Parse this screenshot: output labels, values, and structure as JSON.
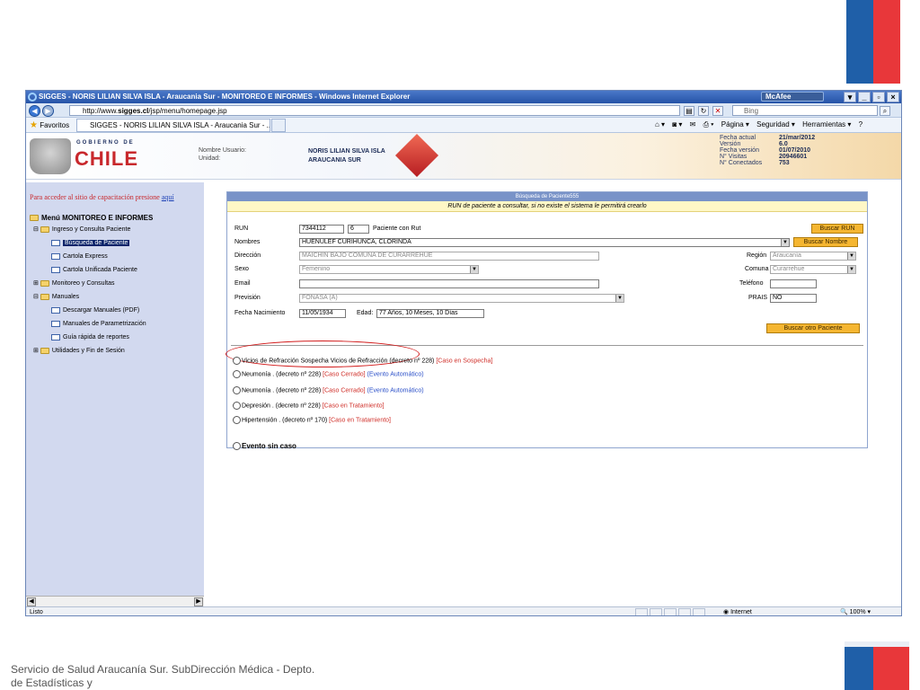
{
  "slide": {
    "footer": "Servicio de Salud Araucanía Sur. SubDirección Médica - Depto. de Estadísticas y"
  },
  "browser": {
    "title": "SIGGES - NORIS LILIAN SILVA ISLA - Araucania Sur - MONITOREO E INFORMES - Windows Internet Explorer",
    "mcafee": "McAfee",
    "url_prefix": "http://www.",
    "url_host": "sigges.cl",
    "url_path": "/jsp/menu/homepage.jsp",
    "search_placeholder": "Bing",
    "favorites_label": "Favoritos",
    "tab_label": "SIGGES - NORIS LILIAN SILVA ISLA - Araucania Sur - ...",
    "commands": [
      "Página ▾",
      "Seguridad ▾",
      "Herramientas ▾"
    ],
    "status_left": "Listo",
    "status_zone": "Internet",
    "zoom": "100%"
  },
  "header": {
    "gobierno": "GOBIERNO DE",
    "chile": "CHILE",
    "user_label": "Nombre Usuario:",
    "unit_label": "Unidad:",
    "user_name": "NORIS LILIAN SILVA ISLA",
    "unit_name": "ARAUCANIA SUR",
    "stats_labels": [
      "Fecha actual",
      "Versión",
      "Fecha versión",
      "N° Visitas",
      "N° Conectados"
    ],
    "stats_values": [
      "21/mar/2012",
      "6.0",
      "01/07/2010",
      "20946601",
      "753"
    ]
  },
  "sidebar": {
    "training_text": "Para acceder al sitio de capacitación presione ",
    "training_link": "aquí",
    "menu_root": "Menú MONITOREO E INFORMES",
    "items": [
      "Ingreso y Consulta Paciente",
      "Búsqueda de Paciente",
      "Cartola Express",
      "Cartola Unificada Paciente",
      "Monitoreo y Consultas",
      "Manuales",
      "Descargar Manuales (PDF)",
      "Manuales de Parametrización",
      "Guía rápida de reportes",
      "Utilidades y Fin de Sesión"
    ]
  },
  "form": {
    "title": "Búsqueda de Paciente555",
    "subtitle": "RUN de paciente a consultar, si no existe el sistema le permitirá crearlo",
    "run_label": "RUN",
    "run_value": "7344112",
    "dv_value": "6",
    "run_note": "Paciente con Rut",
    "nombres_label": "Nombres",
    "nombres_value": "HUENULEF CURIHUNCA, CLORINDA",
    "direccion_label": "Dirección",
    "direccion_value": "MAICHIN BAJO COMUNA DE CURARREHUE",
    "sexo_label": "Sexo",
    "sexo_value": "Femenino",
    "email_label": "Email",
    "email_value": "",
    "prevision_label": "Previsión",
    "prevision_value": "FONASA (A)",
    "nacimiento_label": "Fecha Nacimiento",
    "nacimiento_value": "11/05/1934",
    "edad_label": "Edad",
    "edad_value": "77 Años, 10 Meses, 10 Días",
    "region_label": "Región",
    "region_value": "Araucanía",
    "comuna_label": "Comuna",
    "comuna_value": "Curarrehue",
    "telefono_label": "Teléfono",
    "telefono_value": "",
    "prais_label": "PRAIS",
    "prais_value": "NO",
    "btn_run": "Buscar RUN",
    "btn_nombre": "Buscar Nombre",
    "btn_otro": "Buscar otro Paciente"
  },
  "cases": [
    {
      "text": "Vicios de Refracción Sospecha Vicios de Refracción (decreto nº 228)",
      "status": "[Caso en Sospecha]",
      "extra": ""
    },
    {
      "text": "Neumonía . (decreto nº 228)",
      "status": "[Caso Cerrado]",
      "extra": "(Evento Automático)"
    },
    {
      "text": "Neumonía . (decreto nº 228)",
      "status": "[Caso Cerrado]",
      "extra": "(Evento Automático)"
    },
    {
      "text": "Depresión . (decreto nº 228)",
      "status": "[Caso en Tratamiento]",
      "extra": ""
    },
    {
      "text": "Hipertensión . (decreto nº 170)",
      "status": "[Caso en Tratamiento]",
      "extra": ""
    }
  ],
  "evento_sin_caso": "Evento sin caso",
  "colors": {
    "accent_orange": "#f5b631",
    "panel_header": "#7993c8",
    "sidebar_bg": "#d2d9ef",
    "status_red": "#d0302a",
    "status_blue": "#2a4fc8"
  }
}
